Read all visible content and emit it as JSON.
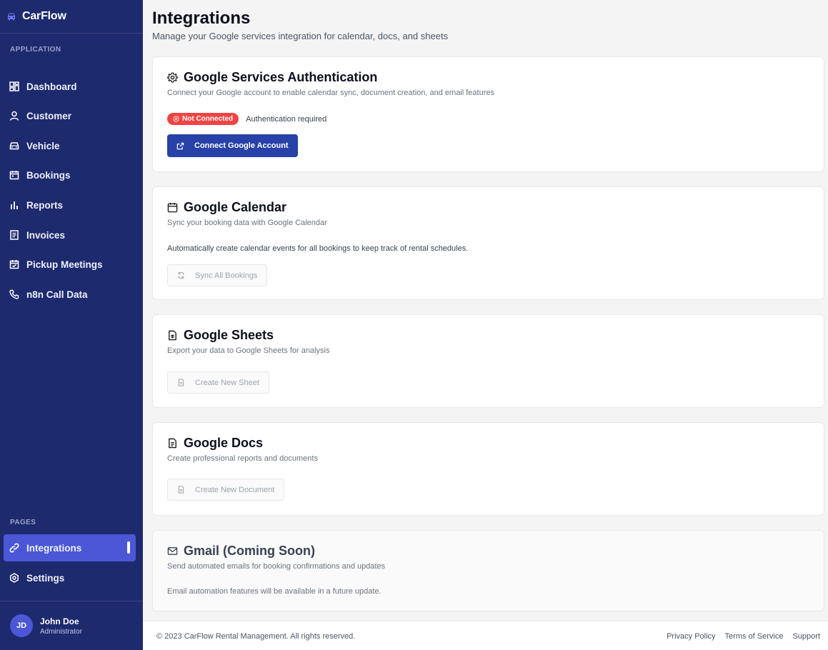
{
  "sidebar": {
    "brand": "CarFlow",
    "section_application": "APPLICATION",
    "section_pages": "PAGES",
    "items": [
      {
        "label": "Dashboard",
        "icon": "dashboard-icon"
      },
      {
        "label": "Customer",
        "icon": "user-icon"
      },
      {
        "label": "Vehicle",
        "icon": "car-icon"
      },
      {
        "label": "Bookings",
        "icon": "calendar-icon"
      },
      {
        "label": "Reports",
        "icon": "bar-chart-icon"
      },
      {
        "label": "Invoices",
        "icon": "invoice-icon"
      },
      {
        "label": "Pickup Meetings",
        "icon": "calendar-check-icon"
      },
      {
        "label": "n8n Call Data",
        "icon": "phone-icon"
      }
    ],
    "pages": [
      {
        "label": "Integrations",
        "icon": "link-icon",
        "active": true
      },
      {
        "label": "Settings",
        "icon": "gear-icon"
      }
    ],
    "user": {
      "initials": "JD",
      "name": "John Doe",
      "role": "Administrator"
    }
  },
  "header": {
    "title": "Integrations",
    "subtitle": "Manage your Google services integration for calendar, docs, and sheets"
  },
  "cards": {
    "auth": {
      "title": "Google Services Authentication",
      "description": "Connect your Google account to enable calendar sync, document creation, and email features",
      "status_badge": "Not Connected",
      "status_text": "Authentication required",
      "button": "Connect Google Account"
    },
    "calendar": {
      "title": "Google Calendar",
      "description": "Sync your booking data with Google Calendar",
      "body": "Automatically create calendar events for all bookings to keep track of rental schedules.",
      "button": "Sync All Bookings"
    },
    "sheets": {
      "title": "Google Sheets",
      "description": "Export your data to Google Sheets for analysis",
      "button": "Create New Sheet"
    },
    "docs": {
      "title": "Google Docs",
      "description": "Create professional reports and documents",
      "button": "Create New Document"
    },
    "gmail": {
      "title": "Gmail (Coming Soon)",
      "description": "Send automated emails for booking confirmations and updates",
      "body": "Email automation features will be available in a future update."
    }
  },
  "footer": {
    "copyright": "© 2023 CarFlow Rental Management. All rights reserved.",
    "links": [
      "Privacy Policy",
      "Terms of Service",
      "Support"
    ]
  },
  "colors": {
    "sidebar_bg": "#1e2a6e",
    "active_item": "#4b57d6",
    "primary_button": "#2741a8",
    "danger_badge": "#ef4444"
  }
}
